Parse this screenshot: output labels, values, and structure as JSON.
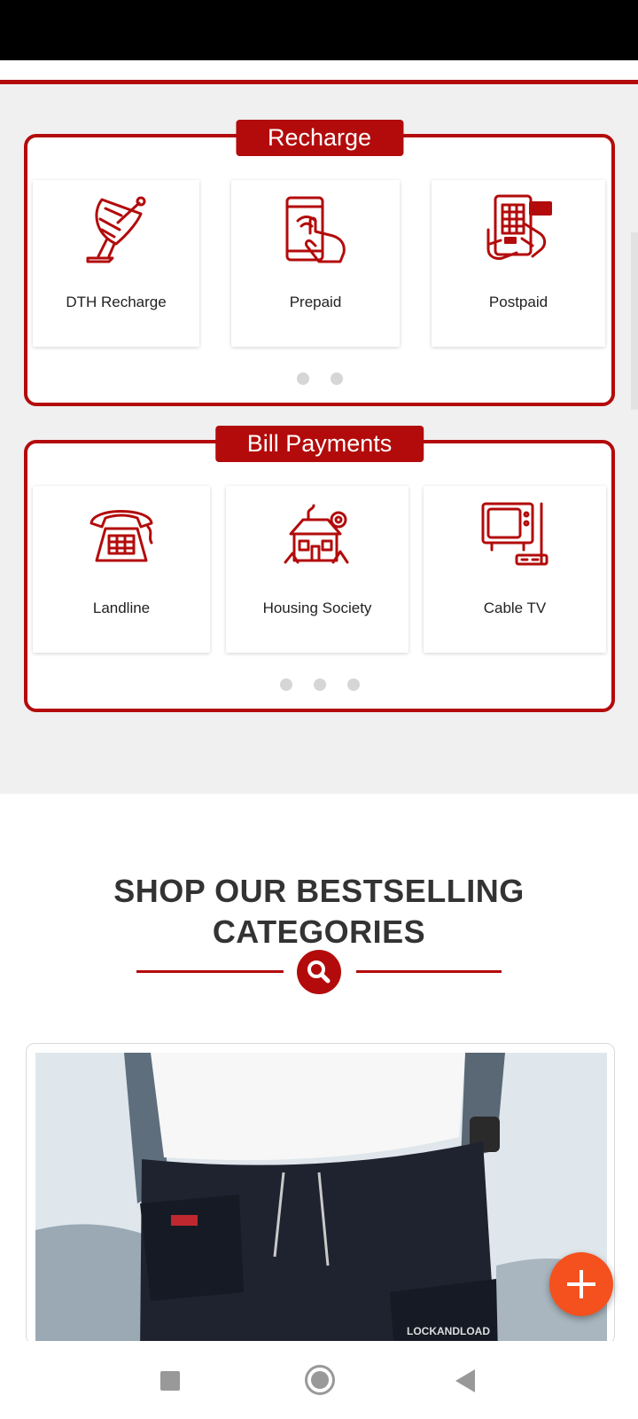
{
  "recharge": {
    "title": "Recharge",
    "items": [
      {
        "label": "DTH Recharge",
        "icon": "satellite-dish-icon"
      },
      {
        "label": "Prepaid",
        "icon": "phone-tap-icon"
      },
      {
        "label": "Postpaid",
        "icon": "phone-bill-icon"
      }
    ],
    "page_count": 2
  },
  "bill_payments": {
    "title": "Bill Payments",
    "items": [
      {
        "label": "Landline",
        "icon": "telephone-icon"
      },
      {
        "label": "Housing Society",
        "icon": "house-icon"
      },
      {
        "label": "Cable TV",
        "icon": "tv-icon"
      }
    ],
    "page_count": 3
  },
  "categories": {
    "heading_line1": "SHOP OUR BESTSELLING",
    "heading_line2": "CATEGORIES",
    "search_icon": "search-icon",
    "product_image": "cargo-pants-model-image",
    "product_text": "LOCKANDLOAD"
  },
  "fab": {
    "icon": "plus-icon"
  },
  "navigation": {
    "recents": "square-icon",
    "home": "circle-icon",
    "back": "triangle-back-icon"
  },
  "colors": {
    "accent": "#b30b0b",
    "fab": "#f4511e",
    "background": "#f0f0f0"
  }
}
